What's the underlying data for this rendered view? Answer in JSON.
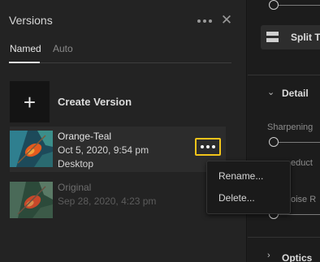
{
  "versions_panel": {
    "title": "Versions",
    "tabs": [
      {
        "label": "Named",
        "active": true
      },
      {
        "label": "Auto",
        "active": false
      }
    ],
    "create_version": {
      "label": "Create Version"
    },
    "versions": [
      {
        "name": "Orange-Teal",
        "date": "Oct 5, 2020, 9:54 pm",
        "source": "Desktop"
      },
      {
        "name": "Original",
        "date": "Sep 28, 2020, 4:23 pm"
      }
    ]
  },
  "context_menu": {
    "items": [
      "Rename...",
      "Delete..."
    ]
  },
  "develop_panel": {
    "split_button_label": "Split Te",
    "detail_section": {
      "title": "Detail",
      "sharpening_label": "Sharpening",
      "noise_reduction_label": "educt",
      "color_noise_label": "oise R"
    },
    "optics_section": {
      "title": "Optics"
    }
  },
  "colors": {
    "panel_bg": "#232323",
    "highlight_outline": "#f2c41a",
    "selected_row_bg": "#2c2c2c"
  }
}
